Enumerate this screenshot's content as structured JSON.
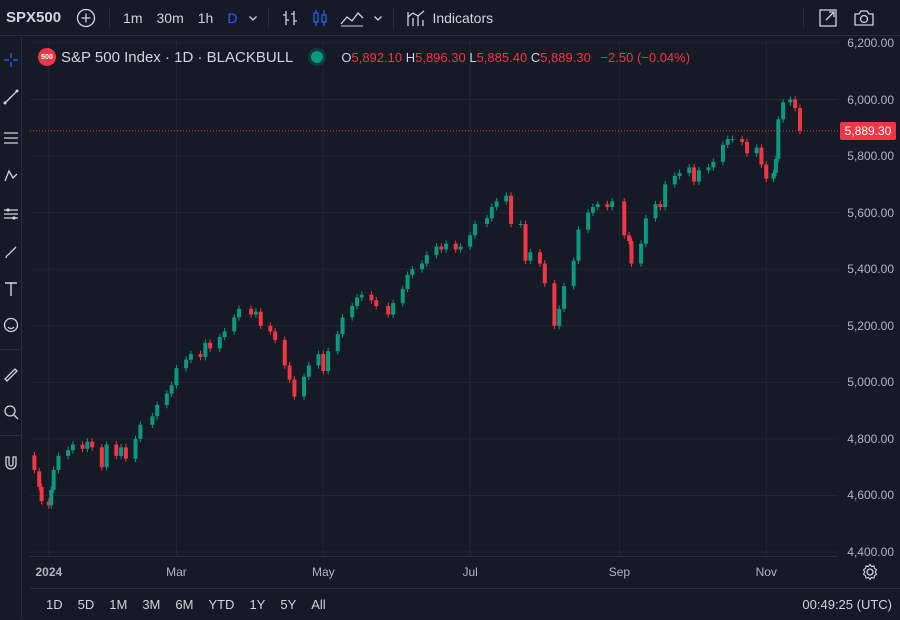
{
  "toolbar": {
    "symbol": "SPX500",
    "timeframes": [
      "1m",
      "30m",
      "1h",
      "D"
    ],
    "active_timeframe": "D",
    "indicators_label": "Indicators"
  },
  "legend": {
    "logo_text": "500",
    "title": "S&P 500 Index · 1D · BLACKBULL",
    "open_label": "O",
    "open": "5,892.10",
    "high_label": "H",
    "high": "5,896.30",
    "low_label": "L",
    "low": "5,885.40",
    "close_label": "C",
    "close": "5,889.30",
    "change": "−2.50 (−0.04%)"
  },
  "price_axis": {
    "labels": [
      "6,200.00",
      "6,000.00",
      "5,800.00",
      "5,600.00",
      "5,400.00",
      "5,200.00",
      "5,000.00",
      "4,800.00",
      "4,600.00",
      "4,400.00"
    ],
    "current_price": "5,889.30"
  },
  "time_axis": {
    "labels": [
      "2024",
      "Mar",
      "May",
      "Jul",
      "Sep",
      "Nov"
    ]
  },
  "bottom": {
    "ranges": [
      "1D",
      "5D",
      "1M",
      "3M",
      "6M",
      "YTD",
      "1Y",
      "5Y",
      "All"
    ],
    "clock": "00:49:25 (UTC)"
  },
  "colors": {
    "up": "#089981",
    "down": "#f23645",
    "background": "#161a25",
    "grid": "#232632",
    "accent": "#2962ff"
  },
  "chart_data": {
    "type": "candlestick",
    "ylim": [
      4400,
      6200
    ],
    "y_ticks": [
      4400,
      4600,
      4800,
      5000,
      5200,
      5400,
      5600,
      5800,
      6000,
      6200
    ],
    "last_price": 5889.3,
    "series": [
      {
        "day": "2024-01-02",
        "o": 4742,
        "c": 4690
      },
      {
        "day": "2024-01-04",
        "o": 4685,
        "c": 4630
      },
      {
        "day": "2024-01-05",
        "o": 4630,
        "c": 4580
      },
      {
        "day": "2024-01-08",
        "o": 4578,
        "c": 4565
      },
      {
        "day": "2024-01-09",
        "o": 4565,
        "c": 4620
      },
      {
        "day": "2024-01-10",
        "o": 4620,
        "c": 4690
      },
      {
        "day": "2024-01-12",
        "o": 4690,
        "c": 4740
      },
      {
        "day": "2024-01-16",
        "o": 4740,
        "c": 4760
      },
      {
        "day": "2024-01-18",
        "o": 4760,
        "c": 4780
      },
      {
        "day": "2024-01-22",
        "o": 4780,
        "c": 4765
      },
      {
        "day": "2024-01-24",
        "o": 4765,
        "c": 4790
      },
      {
        "day": "2024-01-26",
        "o": 4790,
        "c": 4770
      },
      {
        "day": "2024-01-30",
        "o": 4770,
        "c": 4700
      },
      {
        "day": "2024-02-01",
        "o": 4700,
        "c": 4780
      },
      {
        "day": "2024-02-05",
        "o": 4780,
        "c": 4740
      },
      {
        "day": "2024-02-07",
        "o": 4740,
        "c": 4770
      },
      {
        "day": "2024-02-09",
        "o": 4770,
        "c": 4730
      },
      {
        "day": "2024-02-13",
        "o": 4730,
        "c": 4800
      },
      {
        "day": "2024-02-15",
        "o": 4800,
        "c": 4850
      },
      {
        "day": "2024-02-20",
        "o": 4850,
        "c": 4880
      },
      {
        "day": "2024-02-22",
        "o": 4880,
        "c": 4920
      },
      {
        "day": "2024-02-26",
        "o": 4920,
        "c": 4960
      },
      {
        "day": "2024-02-28",
        "o": 4960,
        "c": 4990
      },
      {
        "day": "2024-03-01",
        "o": 4990,
        "c": 5050
      },
      {
        "day": "2024-03-05",
        "o": 5050,
        "c": 5080
      },
      {
        "day": "2024-03-07",
        "o": 5080,
        "c": 5100
      },
      {
        "day": "2024-03-11",
        "o": 5100,
        "c": 5090
      },
      {
        "day": "2024-03-13",
        "o": 5090,
        "c": 5140
      },
      {
        "day": "2024-03-15",
        "o": 5140,
        "c": 5120
      },
      {
        "day": "2024-03-19",
        "o": 5120,
        "c": 5160
      },
      {
        "day": "2024-03-21",
        "o": 5160,
        "c": 5180
      },
      {
        "day": "2024-03-25",
        "o": 5180,
        "c": 5230
      },
      {
        "day": "2024-03-27",
        "o": 5230,
        "c": 5260
      },
      {
        "day": "2024-04-01",
        "o": 5260,
        "c": 5240
      },
      {
        "day": "2024-04-03",
        "o": 5240,
        "c": 5250
      },
      {
        "day": "2024-04-05",
        "o": 5250,
        "c": 5200
      },
      {
        "day": "2024-04-09",
        "o": 5200,
        "c": 5180
      },
      {
        "day": "2024-04-11",
        "o": 5180,
        "c": 5150
      },
      {
        "day": "2024-04-15",
        "o": 5150,
        "c": 5060
      },
      {
        "day": "2024-04-17",
        "o": 5060,
        "c": 5010
      },
      {
        "day": "2024-04-19",
        "o": 5010,
        "c": 4950
      },
      {
        "day": "2024-04-23",
        "o": 4950,
        "c": 5020
      },
      {
        "day": "2024-04-25",
        "o": 5020,
        "c": 5060
      },
      {
        "day": "2024-04-29",
        "o": 5060,
        "c": 5100
      },
      {
        "day": "2024-05-01",
        "o": 5100,
        "c": 5040
      },
      {
        "day": "2024-05-03",
        "o": 5040,
        "c": 5110
      },
      {
        "day": "2024-05-07",
        "o": 5110,
        "c": 5170
      },
      {
        "day": "2024-05-09",
        "o": 5170,
        "c": 5230
      },
      {
        "day": "2024-05-13",
        "o": 5230,
        "c": 5270
      },
      {
        "day": "2024-05-15",
        "o": 5270,
        "c": 5300
      },
      {
        "day": "2024-05-17",
        "o": 5300,
        "c": 5310
      },
      {
        "day": "2024-05-21",
        "o": 5310,
        "c": 5290
      },
      {
        "day": "2024-05-23",
        "o": 5290,
        "c": 5270
      },
      {
        "day": "2024-05-28",
        "o": 5270,
        "c": 5240
      },
      {
        "day": "2024-05-30",
        "o": 5240,
        "c": 5280
      },
      {
        "day": "2024-06-03",
        "o": 5280,
        "c": 5330
      },
      {
        "day": "2024-06-05",
        "o": 5330,
        "c": 5380
      },
      {
        "day": "2024-06-07",
        "o": 5380,
        "c": 5400
      },
      {
        "day": "2024-06-11",
        "o": 5400,
        "c": 5420
      },
      {
        "day": "2024-06-13",
        "o": 5420,
        "c": 5450
      },
      {
        "day": "2024-06-17",
        "o": 5450,
        "c": 5480
      },
      {
        "day": "2024-06-19",
        "o": 5480,
        "c": 5470
      },
      {
        "day": "2024-06-21",
        "o": 5470,
        "c": 5490
      },
      {
        "day": "2024-06-25",
        "o": 5490,
        "c": 5470
      },
      {
        "day": "2024-06-27",
        "o": 5470,
        "c": 5480
      },
      {
        "day": "2024-07-01",
        "o": 5480,
        "c": 5520
      },
      {
        "day": "2024-07-03",
        "o": 5520,
        "c": 5560
      },
      {
        "day": "2024-07-08",
        "o": 5560,
        "c": 5580
      },
      {
        "day": "2024-07-10",
        "o": 5580,
        "c": 5620
      },
      {
        "day": "2024-07-12",
        "o": 5620,
        "c": 5640
      },
      {
        "day": "2024-07-16",
        "o": 5640,
        "c": 5660
      },
      {
        "day": "2024-07-18",
        "o": 5660,
        "c": 5560
      },
      {
        "day": "2024-07-22",
        "o": 5560,
        "c": 5560
      },
      {
        "day": "2024-07-24",
        "o": 5560,
        "c": 5430
      },
      {
        "day": "2024-07-26",
        "o": 5430,
        "c": 5460
      },
      {
        "day": "2024-07-30",
        "o": 5460,
        "c": 5420
      },
      {
        "day": "2024-08-01",
        "o": 5420,
        "c": 5350
      },
      {
        "day": "2024-08-05",
        "o": 5350,
        "c": 5200
      },
      {
        "day": "2024-08-07",
        "o": 5200,
        "c": 5260
      },
      {
        "day": "2024-08-09",
        "o": 5260,
        "c": 5340
      },
      {
        "day": "2024-08-13",
        "o": 5340,
        "c": 5430
      },
      {
        "day": "2024-08-15",
        "o": 5430,
        "c": 5540
      },
      {
        "day": "2024-08-19",
        "o": 5540,
        "c": 5600
      },
      {
        "day": "2024-08-21",
        "o": 5600,
        "c": 5620
      },
      {
        "day": "2024-08-23",
        "o": 5620,
        "c": 5630
      },
      {
        "day": "2024-08-27",
        "o": 5630,
        "c": 5620
      },
      {
        "day": "2024-08-29",
        "o": 5620,
        "c": 5640
      },
      {
        "day": "2024-09-03",
        "o": 5640,
        "c": 5520
      },
      {
        "day": "2024-09-05",
        "o": 5520,
        "c": 5500
      },
      {
        "day": "2024-09-06",
        "o": 5500,
        "c": 5420
      },
      {
        "day": "2024-09-10",
        "o": 5420,
        "c": 5490
      },
      {
        "day": "2024-09-12",
        "o": 5490,
        "c": 5580
      },
      {
        "day": "2024-09-16",
        "o": 5580,
        "c": 5630
      },
      {
        "day": "2024-09-18",
        "o": 5630,
        "c": 5620
      },
      {
        "day": "2024-09-20",
        "o": 5620,
        "c": 5700
      },
      {
        "day": "2024-09-24",
        "o": 5700,
        "c": 5730
      },
      {
        "day": "2024-09-26",
        "o": 5730,
        "c": 5740
      },
      {
        "day": "2024-09-30",
        "o": 5740,
        "c": 5760
      },
      {
        "day": "2024-10-02",
        "o": 5760,
        "c": 5710
      },
      {
        "day": "2024-10-04",
        "o": 5710,
        "c": 5750
      },
      {
        "day": "2024-10-08",
        "o": 5750,
        "c": 5760
      },
      {
        "day": "2024-10-10",
        "o": 5760,
        "c": 5780
      },
      {
        "day": "2024-10-14",
        "o": 5780,
        "c": 5840
      },
      {
        "day": "2024-10-16",
        "o": 5840,
        "c": 5860
      },
      {
        "day": "2024-10-18",
        "o": 5860,
        "c": 5860
      },
      {
        "day": "2024-10-22",
        "o": 5860,
        "c": 5850
      },
      {
        "day": "2024-10-24",
        "o": 5850,
        "c": 5810
      },
      {
        "day": "2024-10-28",
        "o": 5810,
        "c": 5830
      },
      {
        "day": "2024-10-30",
        "o": 5830,
        "c": 5770
      },
      {
        "day": "2024-11-01",
        "o": 5770,
        "c": 5720
      },
      {
        "day": "2024-11-04",
        "o": 5720,
        "c": 5740
      },
      {
        "day": "2024-11-05",
        "o": 5740,
        "c": 5790
      },
      {
        "day": "2024-11-06",
        "o": 5790,
        "c": 5930
      },
      {
        "day": "2024-11-08",
        "o": 5930,
        "c": 5990
      },
      {
        "day": "2024-11-11",
        "o": 5990,
        "c": 6000
      },
      {
        "day": "2024-11-13",
        "o": 6000,
        "c": 5970
      },
      {
        "day": "2024-11-15",
        "o": 5970,
        "c": 5890
      }
    ]
  }
}
